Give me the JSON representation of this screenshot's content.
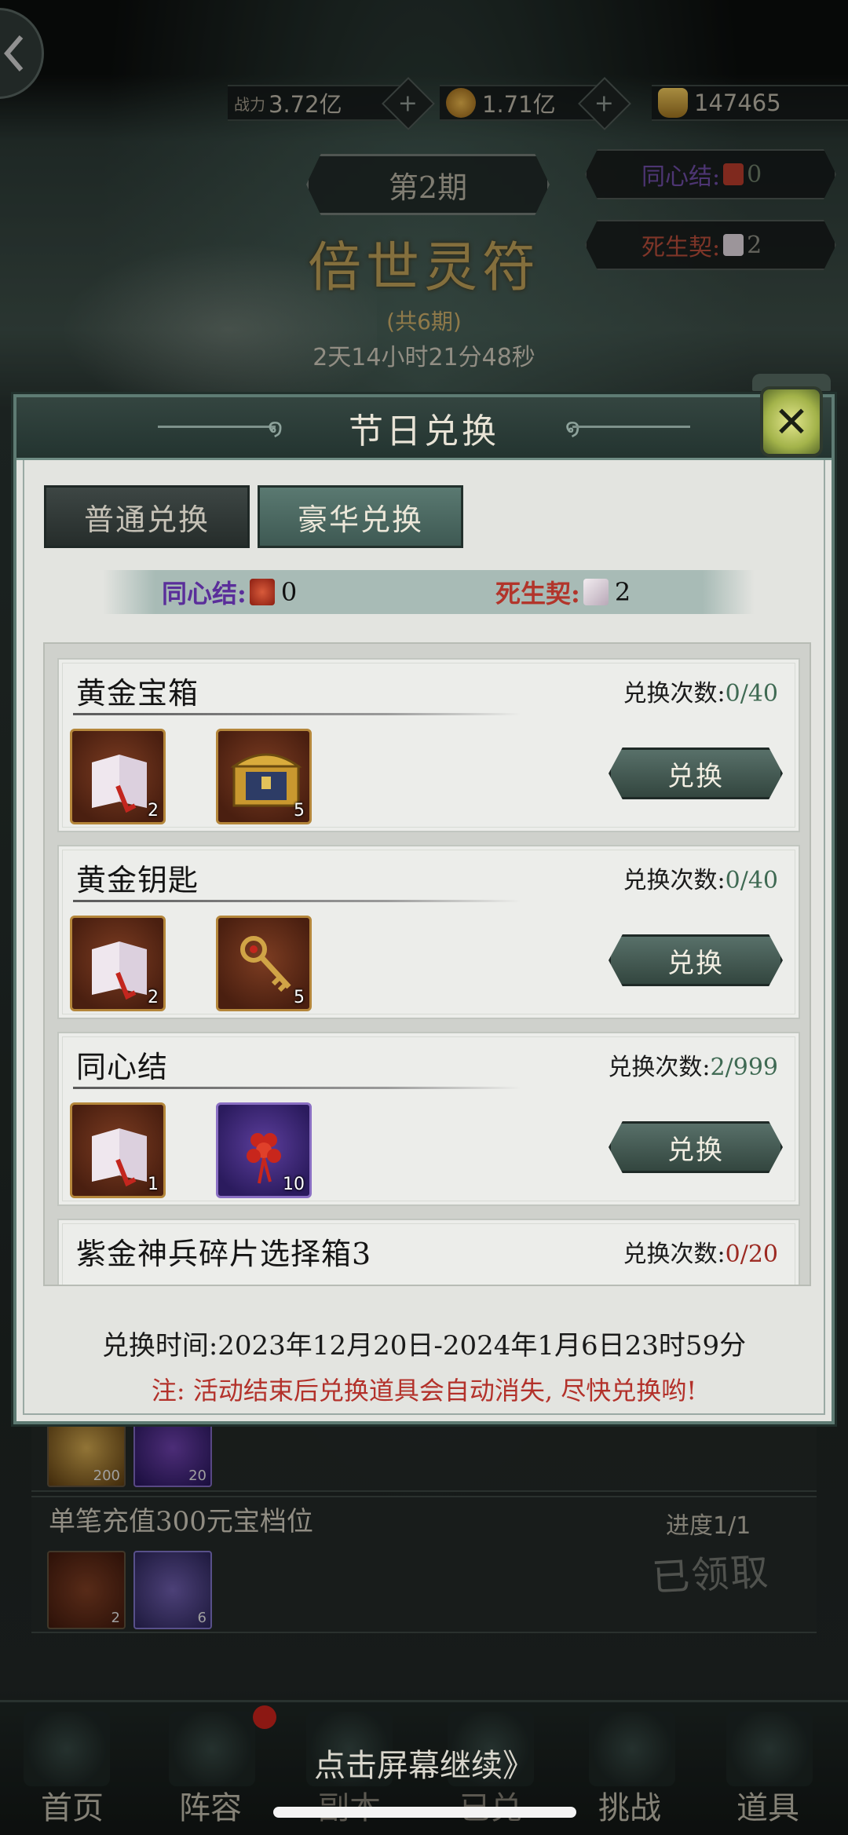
{
  "top": {
    "power_label": "战力",
    "power_value": "3.72亿",
    "coins_value": "1.71亿",
    "ingot_value": "147465"
  },
  "event": {
    "period": "第2期",
    "title": "倍世灵符",
    "total_periods": "(共6期)",
    "countdown": "2天14小时21分48秒",
    "tongxinjie_label": "同心结:",
    "tongxinjie_value": "0",
    "sishengqi_label": "死生契:",
    "sishengqi_value": "2"
  },
  "modal": {
    "title": "节日兑换",
    "tabs": [
      {
        "label": "普通兑换",
        "active": false
      },
      {
        "label": "豪华兑换",
        "active": true
      }
    ],
    "currency": {
      "tongxinjie_label": "同心结:",
      "tongxinjie_value": "0",
      "sishengqi_label": "死生契:",
      "sishengqi_value": "2"
    },
    "count_label": "兑换次数:",
    "button_label": "兑换",
    "items": [
      {
        "title": "黄金宝箱",
        "count": "0/40",
        "cost_qty": "2",
        "reward_qty": "5",
        "reward_icon": "gold-chest-icon"
      },
      {
        "title": "黄金钥匙",
        "count": "0/40",
        "cost_qty": "2",
        "reward_qty": "5",
        "reward_icon": "gold-key-icon"
      },
      {
        "title": "同心结",
        "count": "2/999",
        "cost_qty": "1",
        "reward_qty": "10",
        "reward_icon": "chinese-knot-icon"
      },
      {
        "title": "紫金神兵碎片选择箱3",
        "count": "0/20"
      }
    ],
    "exchange_time": "兑换时间:2023年12月20日-2024年1月6日23时59分",
    "note": "注: 活动结束后兑换道具会自动消失, 尽快兑换哟!"
  },
  "background_list": {
    "row1_qty": [
      "200",
      "20"
    ],
    "row2_title": "单笔充值300元宝档位",
    "row2_progress": "进度1/1",
    "row2_status": "已领取",
    "row2_qty": [
      "2",
      "6"
    ]
  },
  "nav": {
    "items": [
      "首页",
      "阵容",
      "副本",
      "已兑",
      "挑战",
      "道具"
    ],
    "continue_hint": "点击屏幕继续》"
  },
  "colors": {
    "accent": "#3e5953",
    "count_green": "#3f6a53",
    "count_red": "#9c2a22",
    "note_red": "#b3312a",
    "tongxinjie_purple": "#5a2e9a",
    "sishengqi_red": "#b2352b"
  }
}
